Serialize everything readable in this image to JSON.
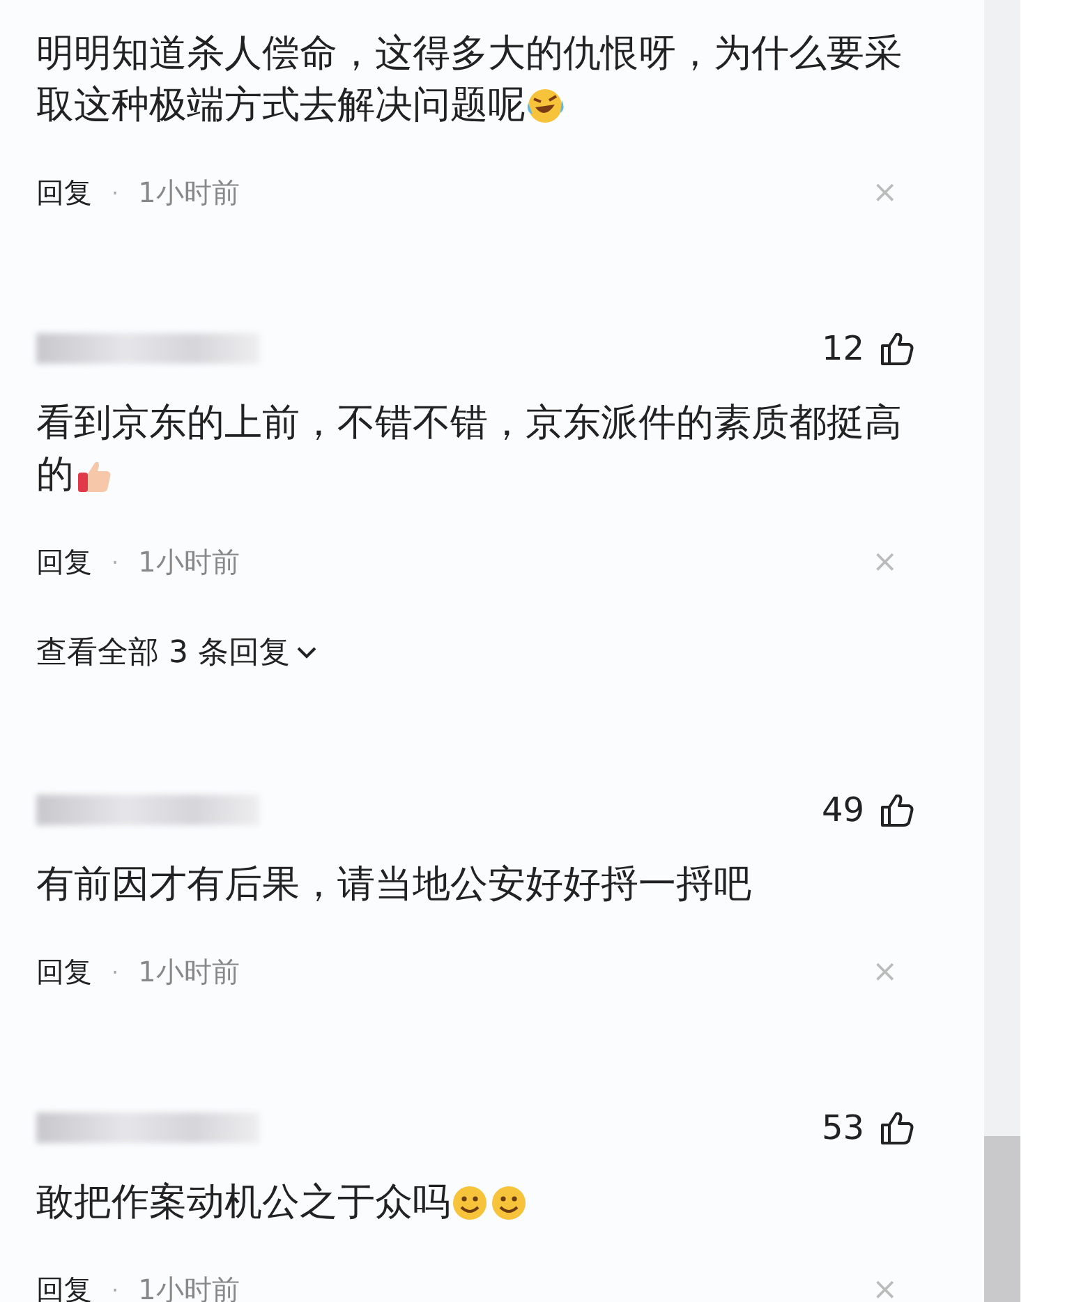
{
  "comments": [
    {
      "lines": [
        "明明知道杀人偿命，这得多大的仇恨呀，为什么要采",
        "取这种极端方式去解决问题呢"
      ],
      "emojis": [
        {
          "kind": "laugh-cry"
        }
      ],
      "reply_label": "回复",
      "separator": "·",
      "time": "1小时前",
      "dismiss": "×"
    },
    {
      "likes": "12",
      "lines": [
        "看到京东的上前，不错不错，京东派件的素质都挺高",
        "的"
      ],
      "emojis": [
        {
          "kind": "thumbs-up"
        }
      ],
      "reply_label": "回复",
      "separator": "·",
      "time": "1小时前",
      "dismiss": "×",
      "view_replies": "查看全部 3 条回复"
    },
    {
      "likes": "49",
      "lines": [
        "有前因才有后果，请当地公安好好捋一捋吧"
      ],
      "reply_label": "回复",
      "separator": "·",
      "time": "1小时前",
      "dismiss": "×"
    },
    {
      "likes": "53",
      "lines": [
        "敢把作案动机公之于众吗"
      ],
      "emojis": [
        {
          "kind": "smile"
        },
        {
          "kind": "smile"
        }
      ],
      "reply_label": "回复",
      "separator": "·",
      "time": "1小时前",
      "dismiss": "×"
    }
  ]
}
